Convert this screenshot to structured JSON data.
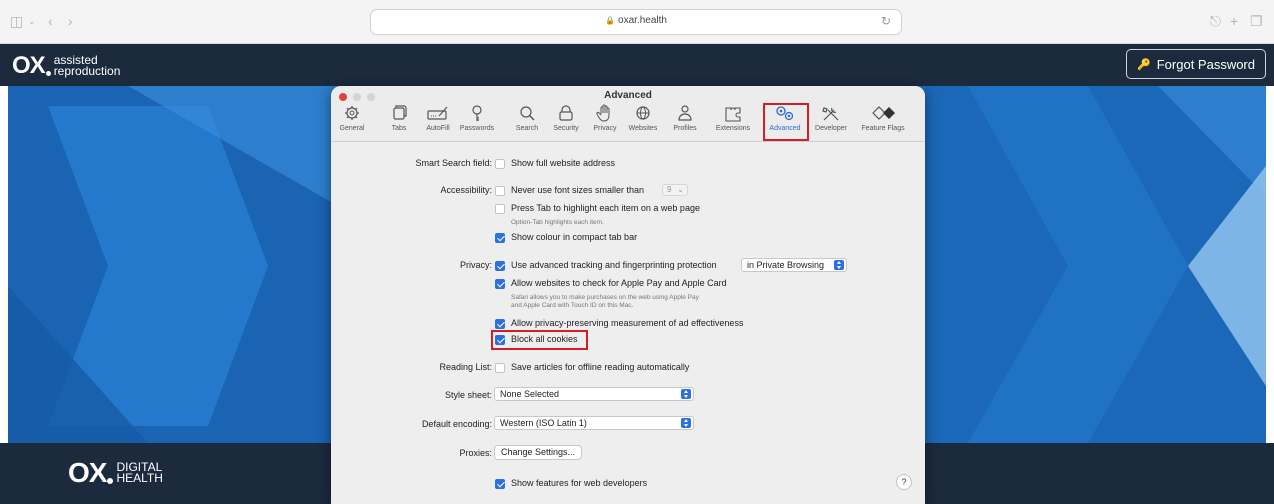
{
  "browser": {
    "url": "oxar.health"
  },
  "site": {
    "logo_text": "OX",
    "logo_sub_line1": "assisted",
    "logo_sub_line2": "reproduction",
    "forgot_password_label": "Forgot Password",
    "footer_logo_text": "OX",
    "footer_sub_line1": "DIGITAL",
    "footer_sub_line2": "HEALTH"
  },
  "window": {
    "title": "Advanced",
    "toolbar": [
      {
        "label": "General",
        "icon": "gear-icon"
      },
      {
        "label": "Tabs",
        "icon": "tabs-icon"
      },
      {
        "label": "AutoFill",
        "icon": "autofill-icon"
      },
      {
        "label": "Passwords",
        "icon": "key-icon"
      },
      {
        "label": "Search",
        "icon": "search-icon"
      },
      {
        "label": "Security",
        "icon": "lock-icon"
      },
      {
        "label": "Privacy",
        "icon": "hand-icon"
      },
      {
        "label": "Websites",
        "icon": "globe-icon"
      },
      {
        "label": "Profiles",
        "icon": "person-icon"
      },
      {
        "label": "Extensions",
        "icon": "puzzle-icon"
      },
      {
        "label": "Advanced",
        "icon": "gears-icon"
      },
      {
        "label": "Developer",
        "icon": "tools-icon"
      },
      {
        "label": "Feature Flags",
        "icon": "flags-icon"
      }
    ],
    "active_tab": "Advanced"
  },
  "settings": {
    "smart_search": {
      "label": "Smart Search field:",
      "option": "Show full website address",
      "checked": false
    },
    "accessibility": {
      "label": "Accessibility:",
      "never_font": "Never use font sizes smaller than",
      "never_font_checked": false,
      "font_size_value": "9",
      "press_tab": "Press Tab to highlight each item on a web page",
      "press_tab_checked": false,
      "press_tab_note": "Option-Tab highlights each item.",
      "show_colour": "Show colour in compact tab bar",
      "show_colour_checked": true
    },
    "privacy": {
      "label": "Privacy:",
      "tracking": "Use advanced tracking and fingerprinting protection",
      "tracking_checked": true,
      "tracking_mode": "in Private Browsing",
      "apple_pay": "Allow websites to check for Apple Pay and Apple Card",
      "apple_pay_checked": true,
      "apple_pay_note_1": "Safari allows you to make purchases on the web using Apple Pay",
      "apple_pay_note_2": "and Apple Card with Touch ID on this Mac.",
      "measurement": "Allow privacy-preserving measurement of ad effectiveness",
      "measurement_checked": true,
      "block_cookies": "Block all cookies",
      "block_cookies_checked": true
    },
    "reading_list": {
      "label": "Reading List:",
      "option": "Save articles for offline reading automatically",
      "checked": false
    },
    "style_sheet": {
      "label": "Style sheet:",
      "value": "None Selected"
    },
    "encoding": {
      "label": "Default encoding:",
      "value": "Western (ISO Latin 1)"
    },
    "proxies": {
      "label": "Proxies:",
      "button": "Change Settings..."
    },
    "developer": {
      "option": "Show features for web developers",
      "checked": true
    },
    "help_label": "?"
  },
  "colors": {
    "brand_dark": "#1c2a3e",
    "hero_blue": "#1d6fc2",
    "accent_blue": "#2b72e0",
    "highlight_red": "#d21f26"
  }
}
